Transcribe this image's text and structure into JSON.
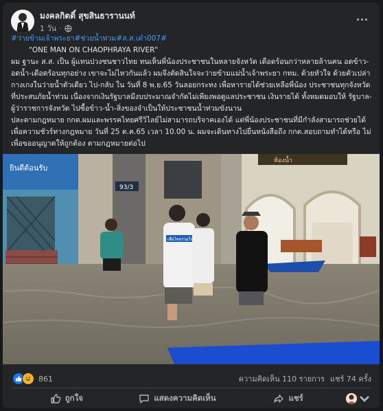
{
  "post": {
    "author": "มงคลกิตติ์ สุขสินธารานนท์",
    "time": "1 วัน",
    "hashtags": [
      "#ว่ายข้ามเจ้าพระยา",
      "#ช่วยน้ำท่วม",
      "#ส.ส.เต๋า007",
      "#"
    ],
    "quote": "\"ONE MAN ON CHAOPHRAYA  RIVER\"",
    "paragraph1": "ผม ฐานะ ส.ส. เป็น ผู้แทนปวงชนชาวไทย ทนเห็นพี่น้องประชาชนในหลายจังหวัด เดือดร้อนกว่าหลายล้านคน อดข้าว-อดน้ำ-เดือดร้อนทุกอย่าง เขาจะไม่ไหวกันแล้ว ผมจึงตัดสินใจจะว่ายข้ามแม่น้ำเจ้าพระยา กทม. ด้วยหัวใจ ด้วยตัวเปล่า กางเกงในว่ายน้ำตัวเดียว  ไป-กลับ ใน วันที่ 8 พ.ย.65 วันลอยกระทง    เพื่อหารายได้ช่วยเหลือพี่น้อง ประชาชนทุกจังหวัดที่ประสบภัยน้ำท่วม เนื่องจากเงินรัฐบาลมีงบประมาณจำกัดไม่เพียงพอดูแลประชาชน  เงินรายได้ ทั้งหมดมอบให้ รัฐบาล-ผู้ว่าราชการจังหวัด ไปซื้อข้าว-น้ำ-สิ่งของจำเป็นให้ประชาชนน้ำท่วมขังนาน",
    "paragraph2": "ปละตามกฎหมาย กกต.ผมและพรรคไทยศรีวิไลย์ไม่สามารถบริจาคเองได้  แต่พี่น้องประชาชนที่มีกำลังสามารถช่วยได้ เพื่อความชัวร์ทางกฎหมาย  วันที่ 25 ต.ค.65 เวลา 10.00 น. ผมจะเดินทางไปยื่นหนังสือถึง กกต.สอบถามทำได้หรือ ไม่ เพื่อขออนุญาตให้ถูกต้อง ตามกฎหมายต่อไป"
  },
  "photo": {
    "sign_top": "ยินดีต้อนรับ",
    "sign_right": "ห้องน้ำ",
    "house_number": "93/3",
    "shirt_text": "เพื่อไทยร่วมใจ"
  },
  "stats": {
    "reaction_count": "861",
    "comments": "ความคิดเห็น 110 รายการ",
    "shares": "แชร์ 74 ครั้ง"
  },
  "actions": {
    "like": "ถูกใจ",
    "comment": "แสดงความคิดเห็น",
    "share": "แชร์"
  },
  "colors": {
    "background": "#18191a",
    "card": "#242526",
    "link": "#4599ff",
    "like_blue": "#1877f2",
    "haha_yellow": "#f7b125"
  }
}
